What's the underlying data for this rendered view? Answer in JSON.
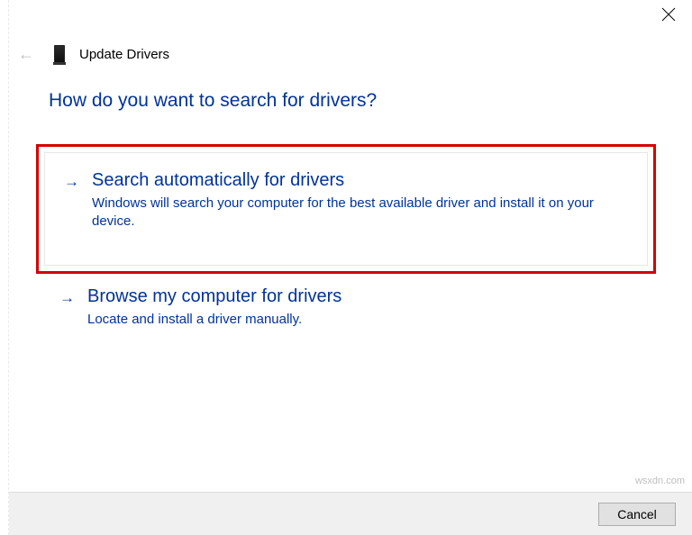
{
  "window": {
    "title": "Update Drivers"
  },
  "question": "How do you want to search for drivers?",
  "options": [
    {
      "title": "Search automatically for drivers",
      "desc": "Windows will search your computer for the best available driver and install it on your device."
    },
    {
      "title": "Browse my computer for drivers",
      "desc": "Locate and install a driver manually."
    }
  ],
  "footer": {
    "cancel": "Cancel"
  },
  "watermark": "wsxdn.com"
}
